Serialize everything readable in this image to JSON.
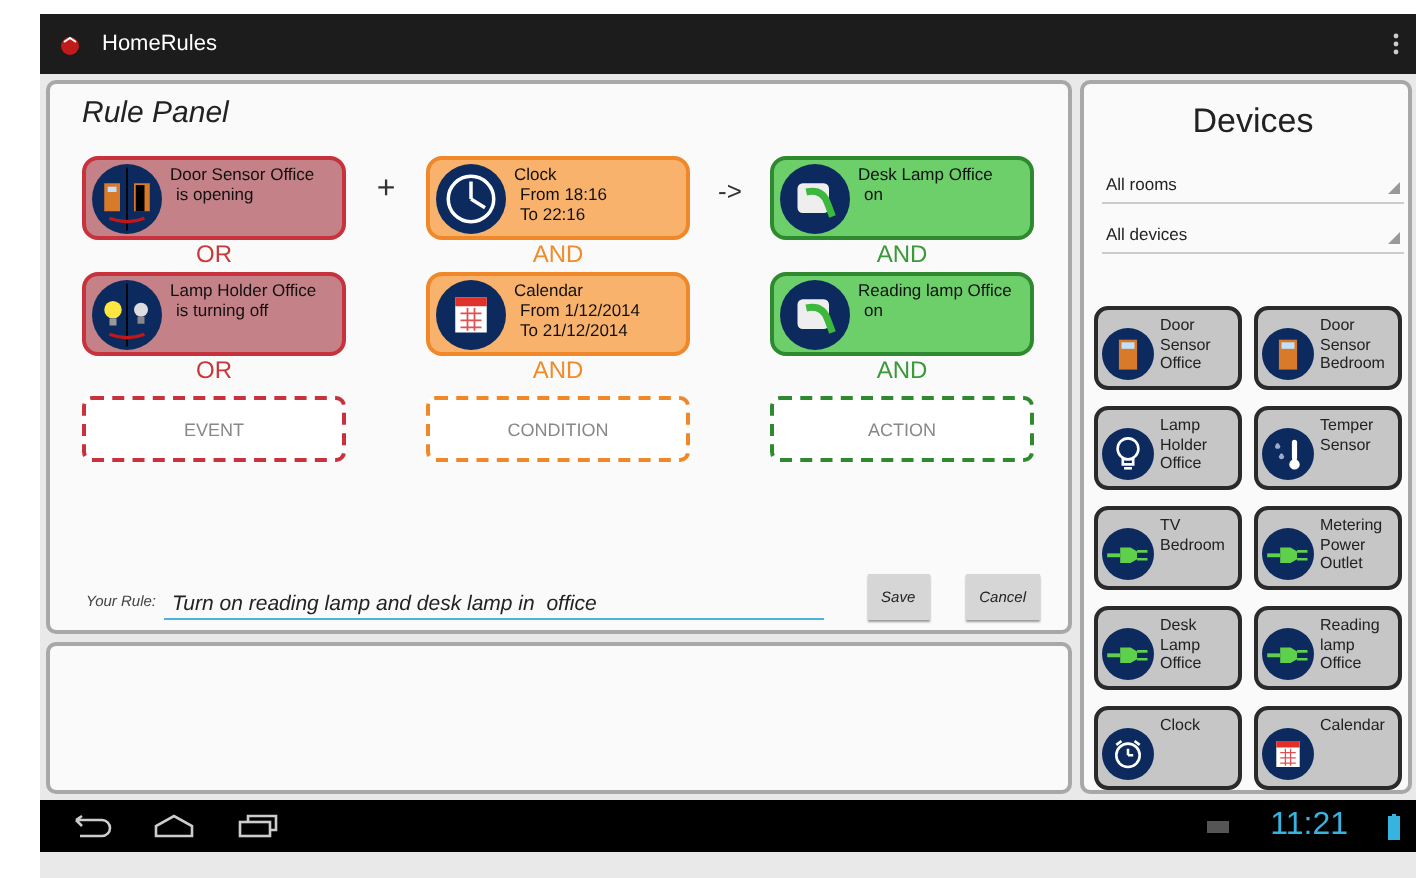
{
  "app_bar": {
    "title": "HomeRules"
  },
  "rule_panel": {
    "title": "Rule Panel",
    "columns": [
      {
        "kind": "event",
        "operator": "+",
        "cards": [
          {
            "kind": "door-pair",
            "title": "Door Sensor Office",
            "lines": [
              "is opening"
            ]
          },
          {
            "kind": "bulb-pair",
            "title": "Lamp Holder Office",
            "lines": [
              "is turning off"
            ]
          }
        ],
        "connectors": [
          "OR",
          "OR"
        ],
        "placeholder": "EVENT"
      },
      {
        "kind": "condition",
        "operator": "->",
        "cards": [
          {
            "kind": "clock",
            "title": "Clock",
            "lines": [
              "From 18:16",
              "To 22:16"
            ]
          },
          {
            "kind": "calendar",
            "title": "Calendar",
            "lines": [
              "From 1/12/2014",
              "To 21/12/2014"
            ]
          }
        ],
        "connectors": [
          "AND",
          "AND"
        ],
        "placeholder": "CONDITION"
      },
      {
        "kind": "action",
        "cards": [
          {
            "kind": "socket",
            "title": "Desk Lamp Office",
            "lines": [
              "on"
            ]
          },
          {
            "kind": "socket",
            "title": "Reading lamp Office",
            "lines": [
              "on"
            ]
          }
        ],
        "connectors": [
          "AND",
          "AND"
        ],
        "placeholder": "ACTION"
      }
    ],
    "rule_label": "Your Rule:",
    "rule_value": "Turn on reading lamp and desk lamp in  office",
    "buttons": [
      "Save",
      "Cancel"
    ]
  },
  "devices": {
    "title": "Devices",
    "filters": [
      "All rooms",
      "All devices"
    ],
    "items": [
      {
        "kind": "door",
        "name": "Door Sensor Office"
      },
      {
        "kind": "door",
        "name": "Door Sensor Bedroom"
      },
      {
        "kind": "bulb",
        "name": "Lamp Holder Office"
      },
      {
        "kind": "thermo",
        "name": "Temper Sensor"
      },
      {
        "kind": "plug",
        "name": "TV Bedroom"
      },
      {
        "kind": "plug",
        "name": "Metering Power Outlet"
      },
      {
        "kind": "plug",
        "name": "Desk Lamp Office"
      },
      {
        "kind": "plug",
        "name": "Reading lamp Office"
      },
      {
        "kind": "alarm",
        "name": "Clock"
      },
      {
        "kind": "calendar",
        "name": "Calendar"
      }
    ]
  },
  "status_bar": {
    "time": "11:21"
  }
}
